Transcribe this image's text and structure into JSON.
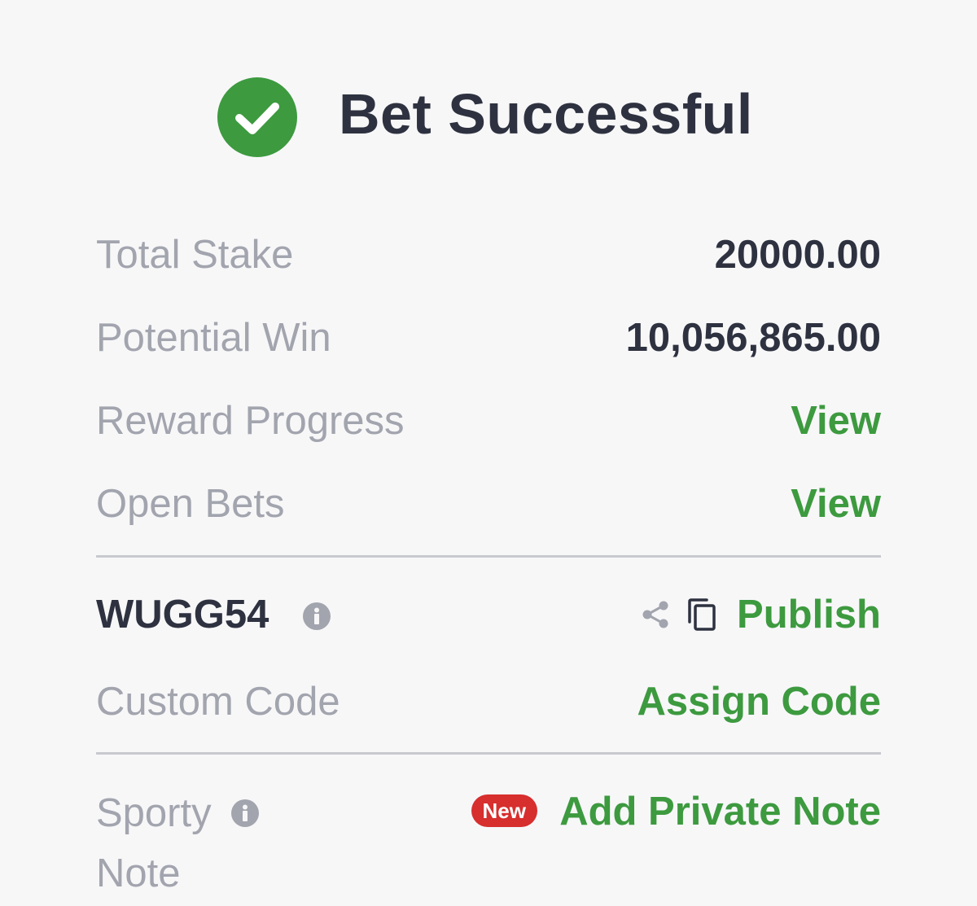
{
  "header": {
    "title": "Bet Successful",
    "icon": "check-circle-icon",
    "icon_color": "#3d9a3f"
  },
  "summary": {
    "total_stake_label": "Total Stake",
    "total_stake_value": "20000.00",
    "potential_win_label": "Potential Win",
    "potential_win_value": "10,056,865.00",
    "reward_progress_label": "Reward Progress",
    "reward_progress_link": "View",
    "open_bets_label": "Open Bets",
    "open_bets_link": "View"
  },
  "booking": {
    "code": "WUGG54",
    "info_icon": "info-icon",
    "share_icon": "share-icon",
    "copy_icon": "copy-icon",
    "publish_label": "Publish",
    "custom_code_label": "Custom Code",
    "assign_code_label": "Assign Code"
  },
  "note": {
    "label_line1": "Sporty",
    "label_line2": "Note",
    "info_icon": "info-icon",
    "badge": "New",
    "badge_color": "#d72e2e",
    "add_note_label": "Add Private Note"
  },
  "colors": {
    "accent": "#3d9a3f",
    "text_dark": "#2e3240",
    "text_muted": "#a2a4ae",
    "divider": "#c8c9ce"
  }
}
